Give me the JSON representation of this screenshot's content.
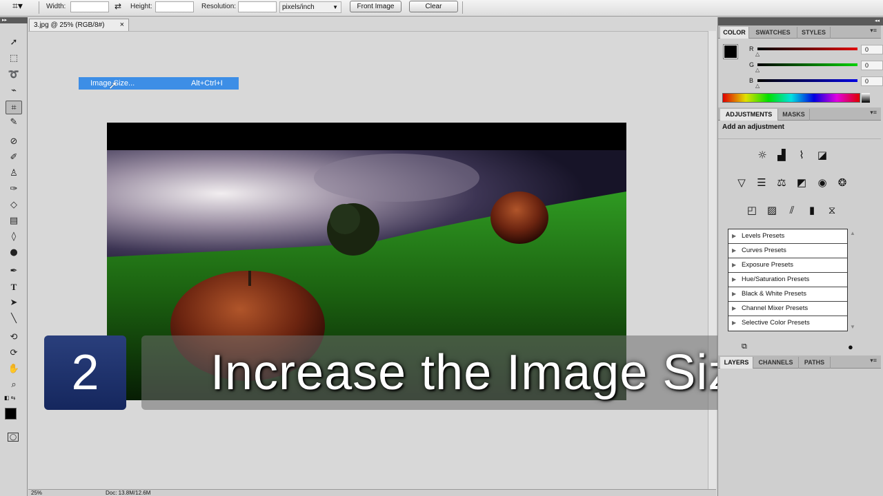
{
  "options_bar": {
    "width_label": "Width:",
    "height_label": "Height:",
    "resolution_label": "Resolution:",
    "units": "pixels/inch",
    "front_image_label": "Front Image",
    "clear_label": "Clear",
    "swap_icon": "swap-icon",
    "crop_icon": "crop-icon"
  },
  "document": {
    "tab_title": "3.jpg @ 25% (RGB/8#)",
    "close_glyph": "×"
  },
  "context_menu": {
    "item_label": "Image Size...",
    "shortcut": "Alt+Ctrl+I"
  },
  "caption": {
    "step_number": "2",
    "text": "Increase the Image Size"
  },
  "status_bar": {
    "zoom": "25%",
    "doc_info": "Doc: 13.8M/12.6M"
  },
  "color_panel": {
    "tabs": [
      "COLOR",
      "SWATCHES",
      "STYLES"
    ],
    "channels": [
      {
        "name": "R",
        "value": "0",
        "color": "#d40000"
      },
      {
        "name": "G",
        "value": "0",
        "color": "#00b400"
      },
      {
        "name": "B",
        "value": "0",
        "color": "#0000c8"
      }
    ],
    "foreground": "#000000",
    "background": "#ffffff"
  },
  "adjustments_panel": {
    "tabs": [
      "ADJUSTMENTS",
      "MASKS"
    ],
    "heading": "Add an adjustment",
    "presets": [
      "Levels Presets",
      "Curves Presets",
      "Exposure Presets",
      "Hue/Saturation Presets",
      "Black & White Presets",
      "Channel Mixer Presets",
      "Selective Color Presets"
    ]
  },
  "layers_panel": {
    "tabs": [
      "LAYERS",
      "CHANNELS",
      "PATHS"
    ]
  }
}
